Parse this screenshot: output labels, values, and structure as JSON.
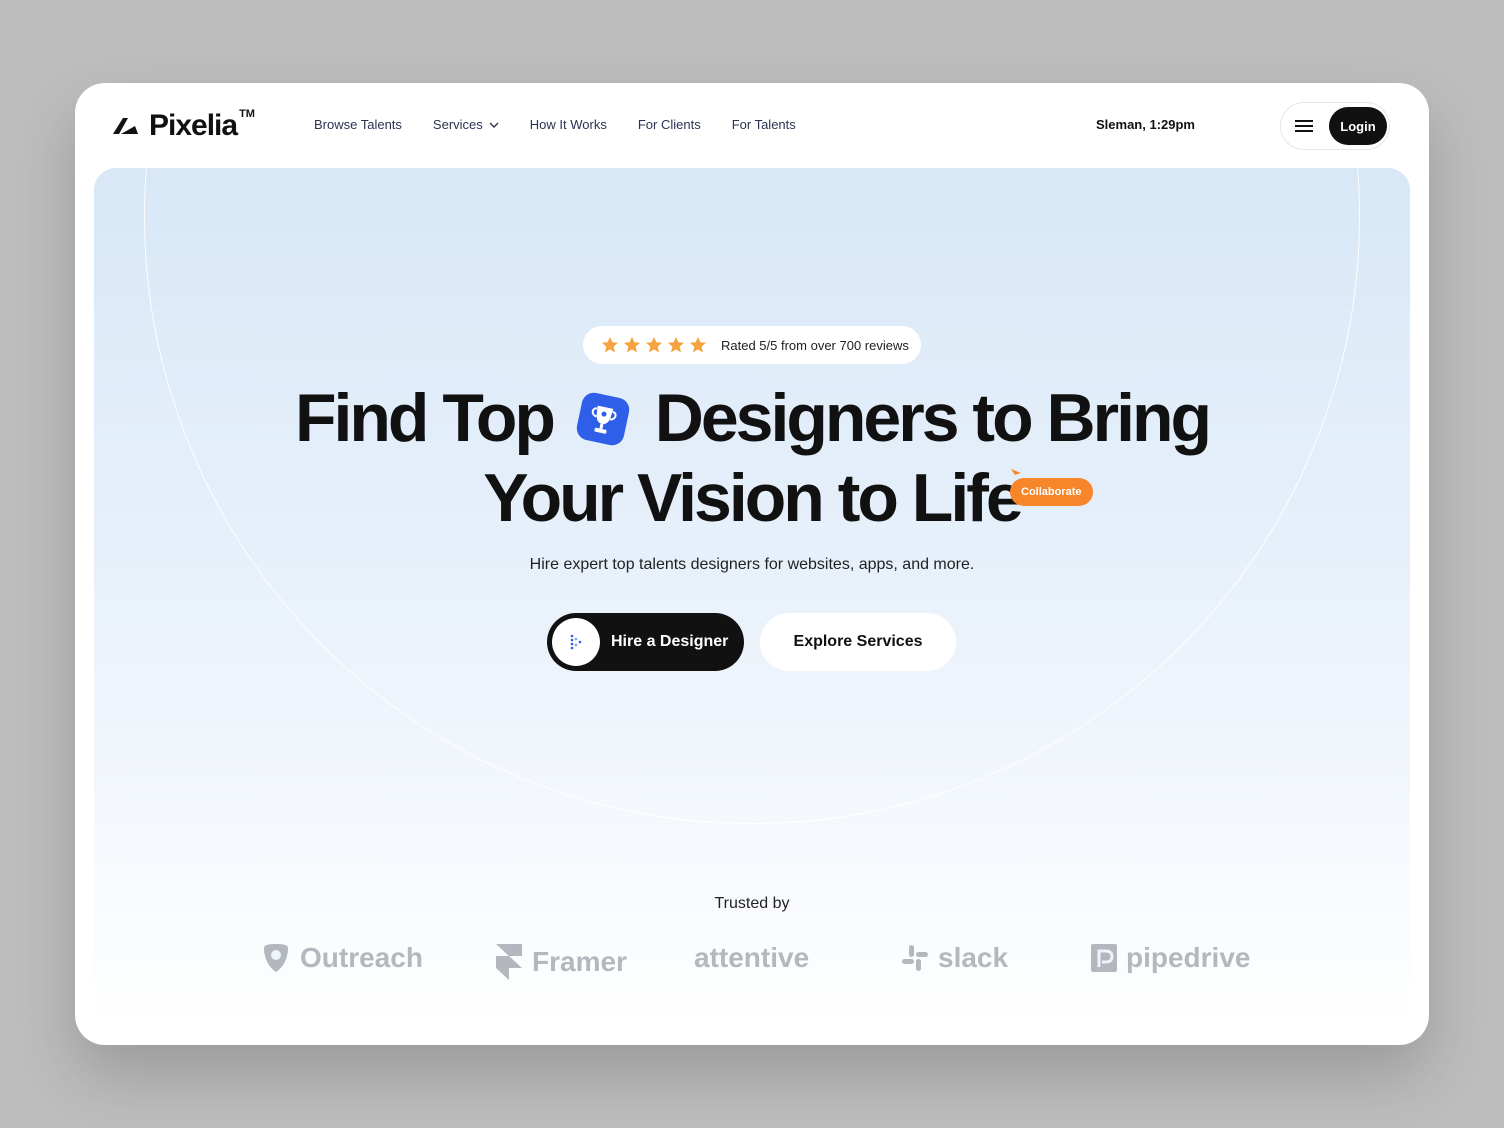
{
  "nav": {
    "logo": {
      "name": "Pixelia",
      "tm": "TM"
    },
    "links": [
      {
        "label": "Browse Talents"
      },
      {
        "label": "Services",
        "has_dropdown": true
      },
      {
        "label": "How It Works"
      },
      {
        "label": "For Clients"
      },
      {
        "label": "For Talents"
      }
    ],
    "clock": "Sleman, 1:29pm",
    "menu_icon": "hamburger-icon",
    "login_label": "Login"
  },
  "hero": {
    "rating": {
      "stars": 5,
      "text": "Rated 5/5 from over 700 reviews"
    },
    "headline_line1_a": "Find Top",
    "headline_line1_b": "Designers to Bring",
    "headline_line2": "Your Vision to Life",
    "badge_label": "Collaborate",
    "subtitle": "Hire expert top talents designers for websites, apps, and more.",
    "cta_primary": "Hire a Designer",
    "cta_secondary": "Explore Services",
    "trusted_by": "Trusted by",
    "brands": [
      {
        "name": "Outreach",
        "icon": "outreach-icon"
      },
      {
        "name": "Framer",
        "icon": "framer-icon"
      },
      {
        "name": "attentive",
        "icon": ""
      },
      {
        "name": "slack",
        "icon": "slack-icon"
      },
      {
        "name": "pipedrive",
        "icon": "pipedrive-icon"
      }
    ]
  },
  "colors": {
    "accent_orange": "#f7862b",
    "star": "#f4a340",
    "icon_blue": "#2f5fe8",
    "dark": "#111111",
    "brand_gray": "#b4b7bd"
  }
}
